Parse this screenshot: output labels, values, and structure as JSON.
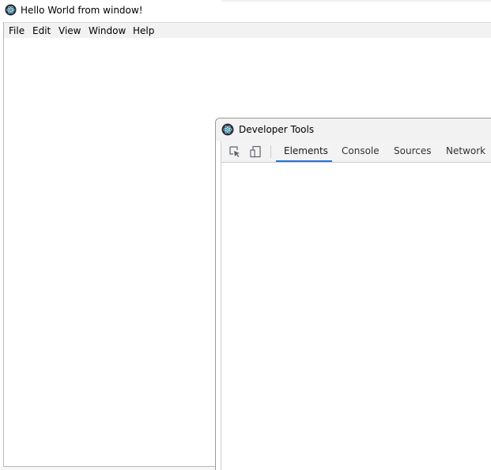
{
  "main_window": {
    "title": "Hello World from window!",
    "icon": "electron-icon",
    "menu": [
      "File",
      "Edit",
      "View",
      "Window",
      "Help"
    ]
  },
  "devtools": {
    "title": "Developer Tools",
    "icon": "electron-icon",
    "tool_icons": [
      "inspect-element-icon",
      "device-toolbar-icon"
    ],
    "tabs": [
      "Elements",
      "Console",
      "Sources",
      "Network"
    ],
    "active_tab": "Elements",
    "accent_color": "#1a73e8"
  }
}
